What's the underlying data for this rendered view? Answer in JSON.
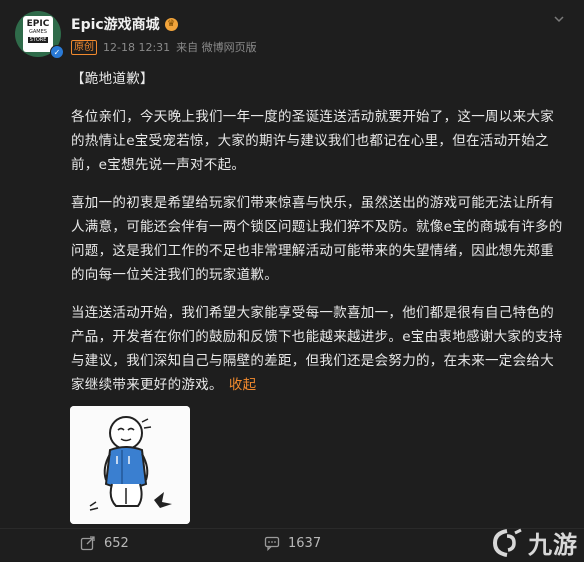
{
  "account": {
    "avatar_line1": "EPIC",
    "avatar_line2": "GAMES",
    "avatar_line3": "STORE",
    "name": "Epic游戏商城",
    "original_badge": "原创",
    "time": "12-18 12:31",
    "source": "来自 微博网页版"
  },
  "post": {
    "title": "【跪地道歉】",
    "para1": "各位亲们，今天晚上我们一年一度的圣诞连送活动就要开始了，这一周以来大家的热情让e宝受宠若惊，大家的期许与建议我们也都记在心里，但在活动开始之前，e宝想先说一声对不起。",
    "para2": "喜加一的初衷是希望给玩家们带来惊喜与快乐，虽然送出的游戏可能无法让所有人满意，可能还会伴有一两个锁区问题让我们猝不及防。就像e宝的商城有许多的问题，这是我们工作的不足也非常理解活动可能带来的失望情绪，因此想先郑重的向每一位关注我们的玩家道歉。",
    "para3": "当连送活动开始，我们希望大家能享受每一款喜加一，他们都是很有自己特色的产品，开发者在你们的鼓励和反馈下也能越来越进步。e宝由衷地感谢大家的支持与建议，我们深知自己与隔壁的差距，但我们还是会努力的，在未来一定会给大家继续带来更好的游戏。",
    "collapse_label": "收起"
  },
  "footer": {
    "reposts": "652",
    "comments": "1637"
  },
  "watermark": {
    "text": "九游"
  },
  "colors": {
    "background": "#1e1e1e",
    "accent": "#f28a2e",
    "verified": "#2a7ad6",
    "crown": "#f2a43b"
  },
  "icons": {
    "more": "chevron-down-icon",
    "repost": "share-icon",
    "comment": "comment-icon",
    "verified": "verified-icon",
    "crown": "crown-icon"
  }
}
